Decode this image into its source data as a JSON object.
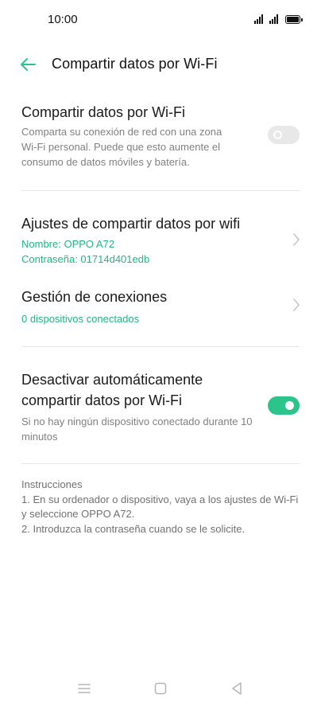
{
  "status_bar": {
    "time": "10:00",
    "icons": [
      "signal-icon",
      "signal-icon",
      "battery-icon"
    ]
  },
  "header": {
    "back_icon": "arrow-left-icon",
    "title": "Compartir datos por Wi-Fi"
  },
  "hotspot": {
    "title": "Compartir datos por Wi-Fi",
    "description": "Comparta su conexión de red con una zona Wi-Fi personal. Puede que esto aumente el consumo de datos móviles y batería.",
    "enabled": false
  },
  "settings": {
    "title": "Ajustes de compartir datos por wifi",
    "name_line": "Nombre: OPPO A72",
    "password_line": "Contraseña: 01714d401edb",
    "icon": "chevron-right-icon"
  },
  "connections": {
    "title": "Gestión de conexiones",
    "subtitle": "0 dispositivos conectados",
    "icon": "chevron-right-icon"
  },
  "auto_off": {
    "title_line1": "Desactivar automáticamente",
    "title_line2": "compartir datos por Wi-Fi",
    "description": "Si no hay ningún dispositivo conectado durante 10 minutos",
    "enabled": true
  },
  "instructions": {
    "heading": "Instrucciones",
    "step1": "1. En su ordenador o dispositivo, vaya a los ajustes de Wi-Fi y seleccione OPPO A72.",
    "step2": "2. Introduzca la contraseña cuando se le solicite."
  },
  "nav_bar": {
    "icons": [
      "menu-icon",
      "home-icon",
      "back-triangle-icon"
    ]
  },
  "colors": {
    "accent": "#2bc48a",
    "accent_text": "#1fb887",
    "toggle_off": "#e8e8e8",
    "secondary_text": "#808080"
  }
}
